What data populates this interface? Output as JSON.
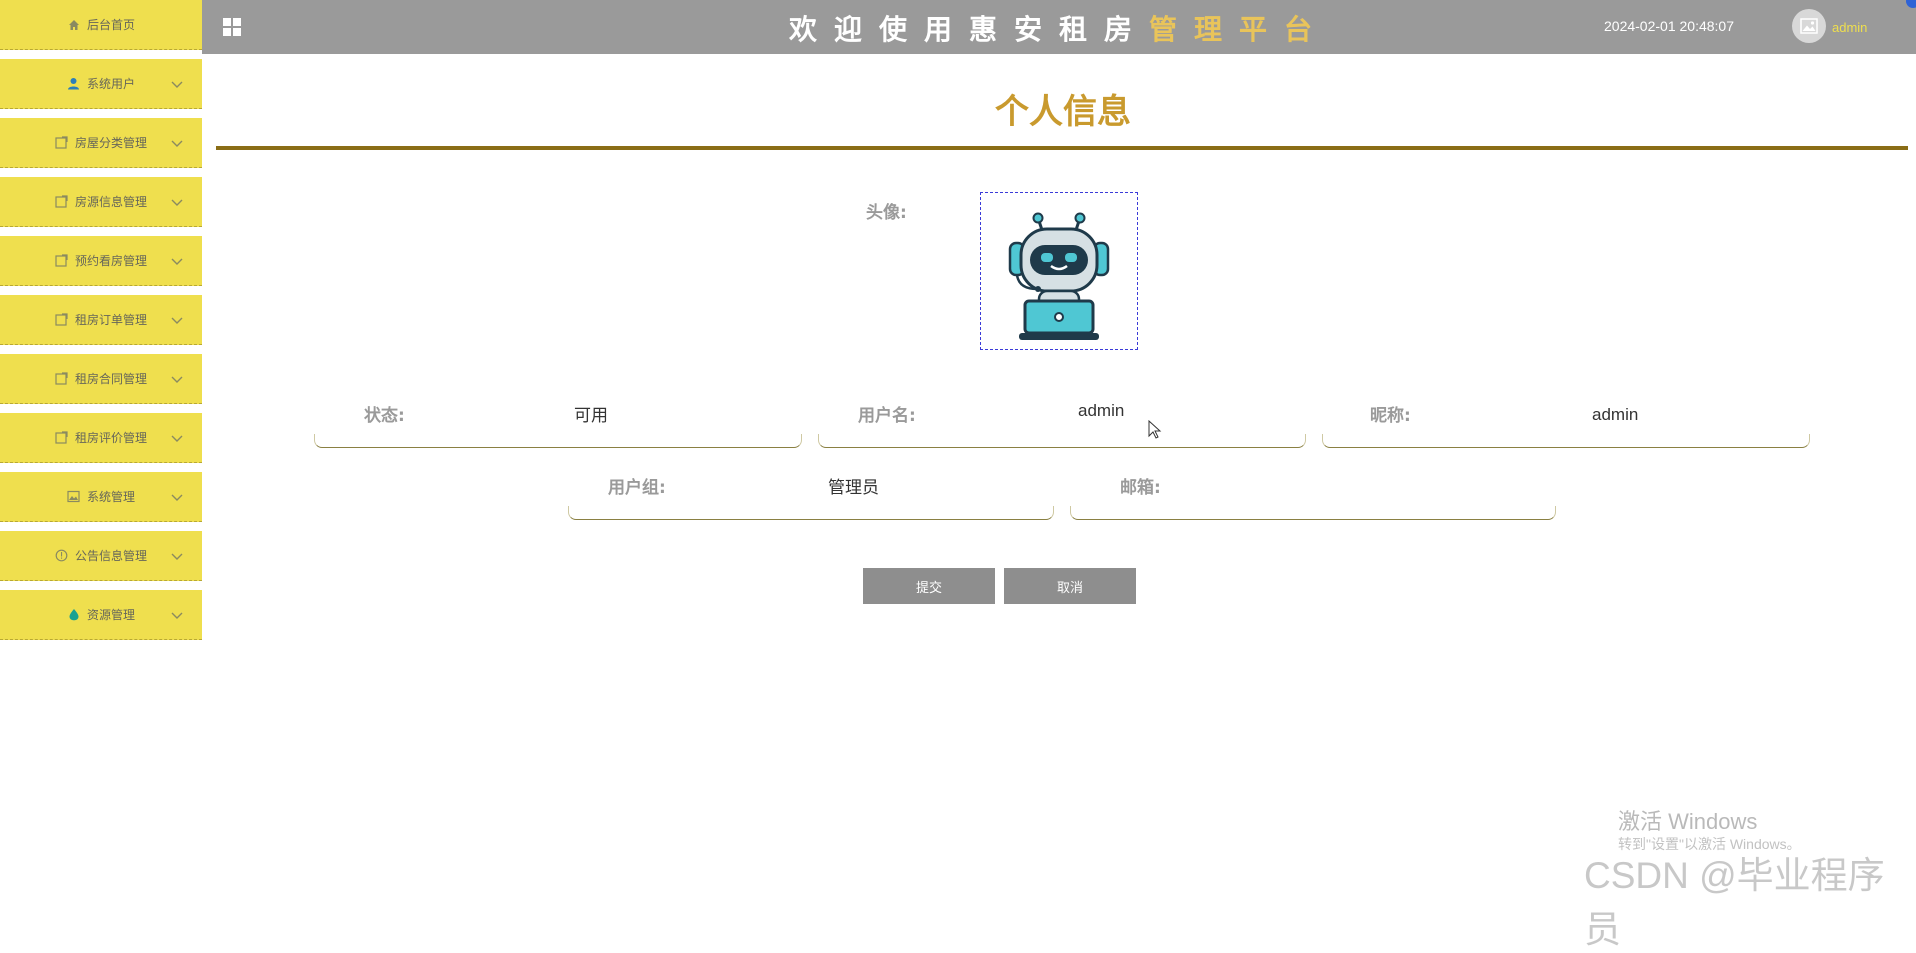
{
  "sidebar": {
    "items": [
      {
        "label": "后台首页",
        "icon": "home-icon"
      },
      {
        "label": "系统用户",
        "icon": "user-icon"
      },
      {
        "label": "房屋分类管理",
        "icon": "edit-icon"
      },
      {
        "label": "房源信息管理",
        "icon": "edit-icon"
      },
      {
        "label": "预约看房管理",
        "icon": "edit-icon"
      },
      {
        "label": "租房订单管理",
        "icon": "edit-icon"
      },
      {
        "label": "租房合同管理",
        "icon": "edit-icon"
      },
      {
        "label": "租房评价管理",
        "icon": "edit-icon"
      },
      {
        "label": "系统管理",
        "icon": "image-icon"
      },
      {
        "label": "公告信息管理",
        "icon": "info-icon"
      },
      {
        "label": "资源管理",
        "icon": "drop-icon"
      }
    ]
  },
  "header": {
    "title_white": "欢迎使用惠安租房",
    "title_gold": "管理平台",
    "datetime": "2024-02-01 20:48:07",
    "user": "admin"
  },
  "main": {
    "page_title": "个人信息",
    "avatar_label": "头像:",
    "fields": {
      "status": {
        "label": "状态:",
        "value": "可用"
      },
      "username": {
        "label": "用户名:",
        "value": "admin"
      },
      "nickname": {
        "label": "昵称:",
        "value": "admin"
      },
      "group": {
        "label": "用户组:",
        "value": "管理员"
      },
      "email": {
        "label": "邮箱:",
        "value": ""
      }
    },
    "submit_label": "提交",
    "cancel_label": "取消"
  },
  "watermark": {
    "activate_title": "激活 Windows",
    "activate_sub": "转到\"设置\"以激活 Windows。",
    "csdn": "CSDN @毕业程序员"
  },
  "colors": {
    "sidebar_bg": "#efdf4e",
    "header_bg": "#9a9a9a",
    "title_gold": "#c99a2e",
    "button_bg": "#8e8e8e"
  }
}
